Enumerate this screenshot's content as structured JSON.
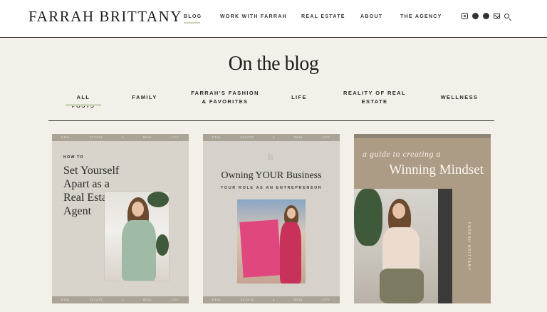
{
  "site": {
    "logo": "FARRAH BRITTANY"
  },
  "nav": {
    "items": [
      "BLOG",
      "WORK WITH FARRAH",
      "REAL ESTATE",
      "ABOUT",
      "THE AGENCY"
    ],
    "active": "BLOG"
  },
  "social_icons": [
    "instagram-icon",
    "pinterest-icon",
    "facebook-icon",
    "mail-icon",
    "search-icon"
  ],
  "page": {
    "heading": "On the blog"
  },
  "tabs": {
    "items": [
      {
        "label": "ALL POSTS"
      },
      {
        "label": "FAMILY"
      },
      {
        "label": "FARRAH'S FASHION & FAVORITES"
      },
      {
        "label": "LIFE"
      },
      {
        "label": "REALITY OF REAL ESTATE"
      },
      {
        "label": "WELLNESS"
      }
    ],
    "active": "ALL POSTS"
  },
  "posts": [
    {
      "kicker": "HOW TO",
      "title": "Set Yourself Apart as a Real Estate Agent",
      "strip": [
        "REAL",
        "ESTATE",
        "&",
        "REAL",
        "LIFE"
      ]
    },
    {
      "title": "Owning YOUR Business",
      "subtitle": "YOUR ROLE AS AN ENTREPRENEUR",
      "strip": [
        "REAL",
        "ESTATE",
        "&",
        "REAL",
        "LIFE"
      ]
    },
    {
      "script": "a guide to creating a",
      "title": "Winning Mindset",
      "vertical": "FARRAH BRITTANY"
    }
  ],
  "colors": {
    "background": "#f3f0ea",
    "accent": "#cfd8bf",
    "card3": "#ac9b85"
  }
}
